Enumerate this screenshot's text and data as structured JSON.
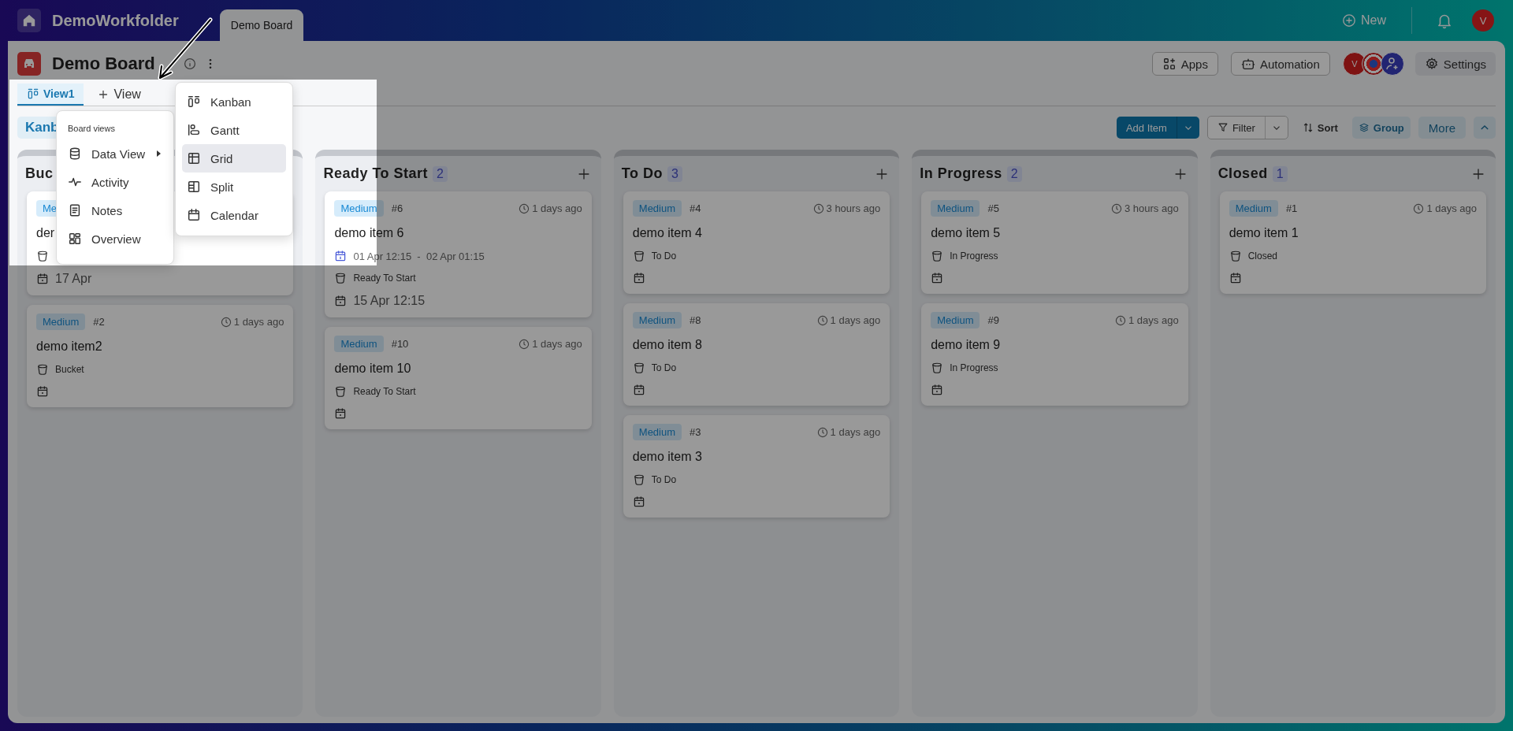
{
  "top_bar": {
    "workspace": "DemoWorkfolder",
    "tabs": [
      {
        "label": "Demo Board",
        "selected": true
      }
    ],
    "new_label": "New",
    "user_initial": "V"
  },
  "board": {
    "title": "Demo Board",
    "apps_label": "Apps",
    "automation_label": "Automation",
    "member_initial": "V",
    "settings_label": "Settings"
  },
  "view_tabs": [
    {
      "label": "View1",
      "selected": true
    }
  ],
  "add_view_label": "View",
  "view_pill": "Kanb",
  "actions": {
    "add_item": "Add Item",
    "filter": "Filter",
    "sort": "Sort",
    "group": "Group",
    "more": "More"
  },
  "columns": [
    {
      "title": "Buc",
      "cards": [
        {
          "priority": "Me",
          "title": "der",
          "due": "17 Apr"
        },
        {
          "priority": "Medium",
          "number": "#2",
          "age": "1 days ago",
          "title": "demo item2",
          "bucket": "Bucket"
        }
      ]
    },
    {
      "title": "Ready To Start",
      "count": "2",
      "cards": [
        {
          "priority": "Medium",
          "number": "#6",
          "age": "1 days ago",
          "title": "demo item 6",
          "date_range": "01 Apr 12:15  -  02 Apr 01:15",
          "bucket": "Ready To Start",
          "due": "15 Apr 12:15"
        },
        {
          "priority": "Medium",
          "number": "#10",
          "age": "1 days ago",
          "title": "demo item 10",
          "bucket": "Ready To Start"
        }
      ]
    },
    {
      "title": "To Do",
      "count": "3",
      "cards": [
        {
          "priority": "Medium",
          "number": "#4",
          "age": "3 hours ago",
          "title": "demo item 4",
          "bucket": "To Do"
        },
        {
          "priority": "Medium",
          "number": "#8",
          "age": "1 days ago",
          "title": "demo item 8",
          "bucket": "To Do"
        },
        {
          "priority": "Medium",
          "number": "#3",
          "age": "1 days ago",
          "title": "demo item 3",
          "bucket": "To Do"
        }
      ]
    },
    {
      "title": "In Progress",
      "count": "2",
      "cards": [
        {
          "priority": "Medium",
          "number": "#5",
          "age": "3 hours ago",
          "title": "demo item 5",
          "bucket": "In Progress"
        },
        {
          "priority": "Medium",
          "number": "#9",
          "age": "1 days ago",
          "title": "demo item 9",
          "bucket": "In Progress"
        }
      ]
    },
    {
      "title": "Closed",
      "count": "1",
      "cards": [
        {
          "priority": "Medium",
          "number": "#1",
          "age": "1 days ago",
          "title": "demo item 1",
          "bucket": "Closed"
        }
      ]
    }
  ],
  "board_views_menu": {
    "heading": "Board views",
    "items": [
      {
        "label": "Data View",
        "has_submenu": true
      },
      {
        "label": "Activity",
        "has_submenu": false
      },
      {
        "label": "Notes",
        "has_submenu": false
      },
      {
        "label": "Overview",
        "has_submenu": false
      }
    ]
  },
  "data_view_submenu": {
    "items": [
      {
        "label": "Kanban",
        "selected": false
      },
      {
        "label": "Gantt",
        "selected": false
      },
      {
        "label": "Grid",
        "selected": true
      },
      {
        "label": "Split",
        "selected": false
      },
      {
        "label": "Calendar",
        "selected": false
      }
    ]
  }
}
